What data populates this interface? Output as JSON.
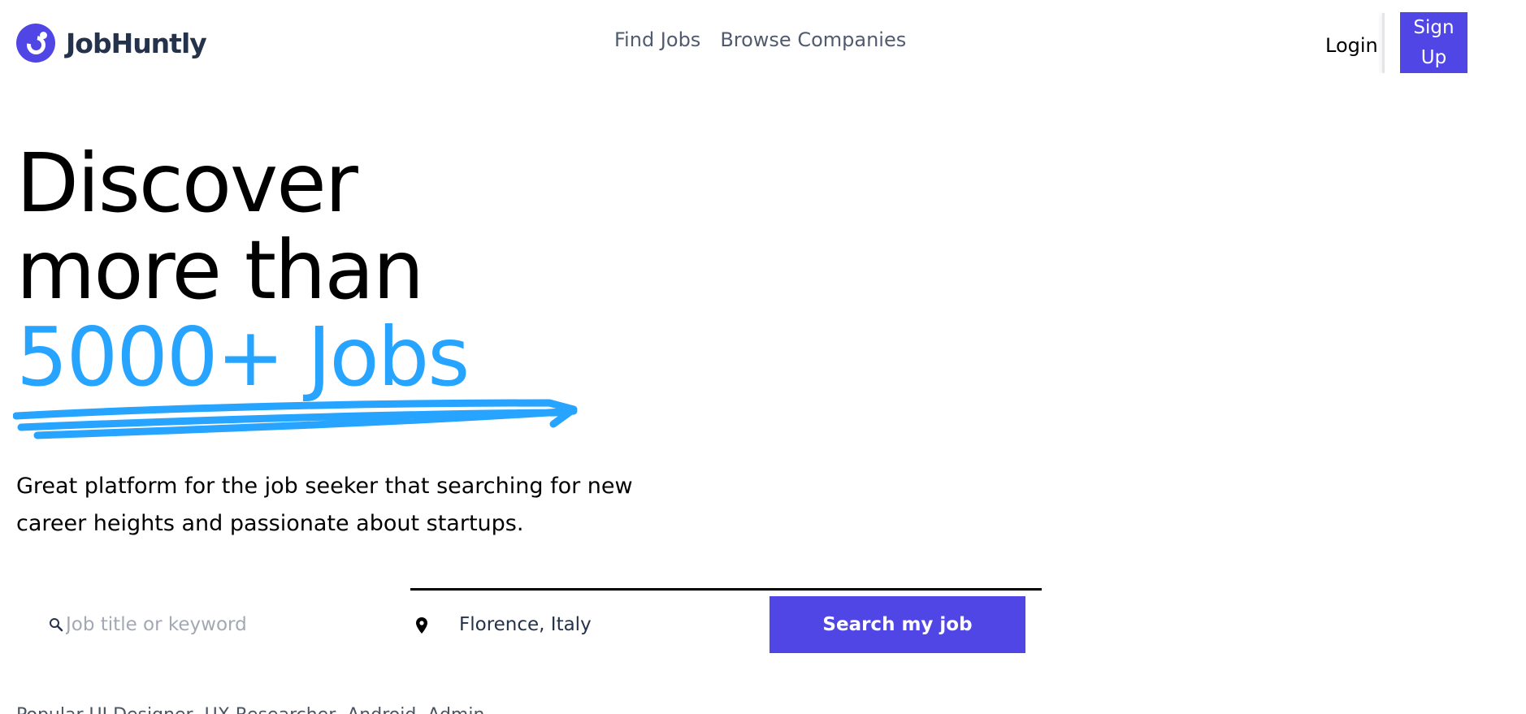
{
  "header": {
    "logo_text": "JobHuntly",
    "nav": [
      {
        "label": "Find Jobs"
      },
      {
        "label": "Browse Companies"
      }
    ],
    "login_label": "Login",
    "signup_label": "Sign Up"
  },
  "hero": {
    "line1": "Discover",
    "line2": "more than",
    "accent": "5000+ Jobs",
    "accent_color": "#26a4ff",
    "subtitle": "Great platform for the job seeker that searching for new career heights and passionate about startups."
  },
  "search": {
    "keyword_placeholder": "Job title or keyword",
    "location_value": "Florence, Italy",
    "button_label": "Search my job"
  },
  "popular": {
    "text": "Popular UI Designer, UX Researcher, Android, Admin"
  },
  "colors": {
    "brand": "#4f46e5",
    "accent": "#26a4ff",
    "nav_text": "#515b6f"
  }
}
